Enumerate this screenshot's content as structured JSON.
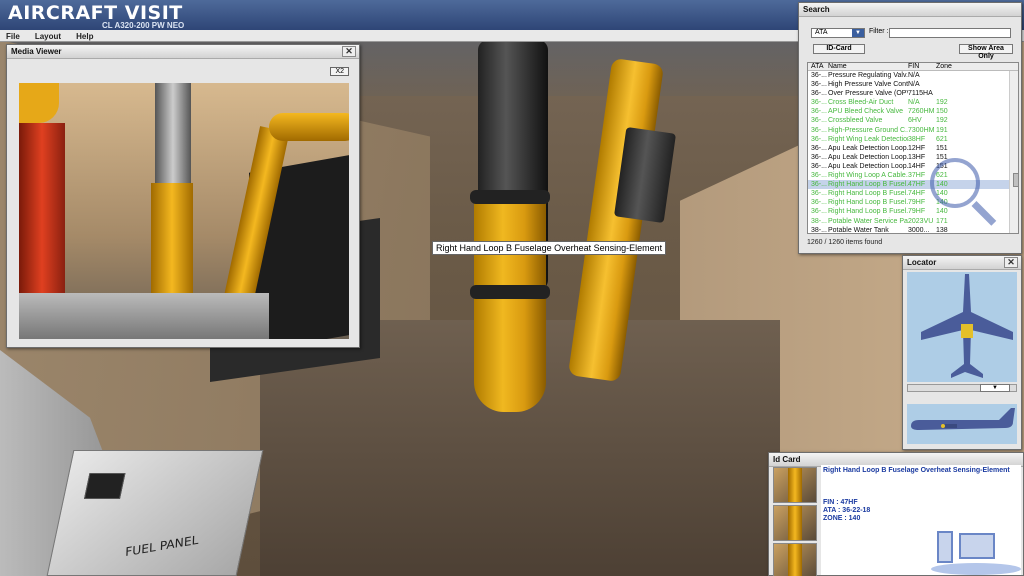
{
  "app": {
    "brand": "AIRCRAFT VISIT",
    "subtitle": "CL A320-200 PW NEO"
  },
  "menu": [
    "File",
    "Layout",
    "Help"
  ],
  "scene": {
    "tooltip": "Right Hand Loop B Fuselage Overheat Sensing-Element",
    "fuel_panel_label": "FUEL PANEL"
  },
  "media_viewer": {
    "title": "Media Viewer",
    "zoom_label": "X2"
  },
  "search": {
    "title": "Search",
    "ata_value": "ATA",
    "filter_label": "Filter :",
    "filter_value": "",
    "idcard_button": "ID-Card",
    "show_area_button": "Show Area Only",
    "columns": [
      "ATA",
      "Name",
      "FIN",
      "Zone"
    ],
    "rows": [
      {
        "ata": "36-...",
        "name": "Pressure Regulating Valv...",
        "fin": "N/A",
        "zone": "",
        "color": "black"
      },
      {
        "ata": "36-...",
        "name": "High Pressure Valve Cont...",
        "fin": "N/A",
        "zone": "",
        "color": "black"
      },
      {
        "ata": "36-...",
        "name": "Over Pressure Valve (OPV)",
        "fin": "7115HA",
        "zone": "",
        "color": "black"
      },
      {
        "ata": "36-...",
        "name": "Cross Bleed-Air Duct",
        "fin": "N/A",
        "zone": "192",
        "color": "green"
      },
      {
        "ata": "36-...",
        "name": "APU Bleed Check Valve",
        "fin": "7260HM",
        "zone": "150",
        "color": "green"
      },
      {
        "ata": "36-...",
        "name": "Crossbleed Valve",
        "fin": "6HV",
        "zone": "192",
        "color": "green"
      },
      {
        "ata": "36-...",
        "name": "High-Pressure Ground C...",
        "fin": "7300HM",
        "zone": "191",
        "color": "green"
      },
      {
        "ata": "36-...",
        "name": "Right Wing Leak Detection...",
        "fin": "38HF",
        "zone": "621",
        "color": "green"
      },
      {
        "ata": "36-...",
        "name": "Apu Leak Detection Loop...",
        "fin": "12HF",
        "zone": "151",
        "color": "black"
      },
      {
        "ata": "36-...",
        "name": "Apu Leak Detection Loop...",
        "fin": "13HF",
        "zone": "151",
        "color": "black"
      },
      {
        "ata": "36-...",
        "name": "Apu Leak Detection Loop...",
        "fin": "14HF",
        "zone": "151",
        "color": "black"
      },
      {
        "ata": "36-...",
        "name": "Right Wing Loop A Cable...",
        "fin": "37HF",
        "zone": "621",
        "color": "green"
      },
      {
        "ata": "36-...",
        "name": "Right Hand Loop B Fusel...",
        "fin": "47HF",
        "zone": "140",
        "color": "green",
        "selected": true
      },
      {
        "ata": "36-...",
        "name": "Right Hand Loop B Fusel...",
        "fin": "74HF",
        "zone": "140",
        "color": "green"
      },
      {
        "ata": "36-...",
        "name": "Right Hand Loop B Fusel...",
        "fin": "79HF",
        "zone": "140",
        "color": "green"
      },
      {
        "ata": "36-...",
        "name": "Right Hand Loop B Fusel...",
        "fin": "79HF",
        "zone": "140",
        "color": "green"
      },
      {
        "ata": "38-...",
        "name": "Potable Water Service Pa...",
        "fin": "2023VU",
        "zone": "171",
        "color": "green"
      },
      {
        "ata": "38-...",
        "name": "Potable Water Tank",
        "fin": "3000...",
        "zone": "138",
        "color": "black"
      }
    ],
    "found_text": "1260 / 1260 items found"
  },
  "locator": {
    "title": "Locator"
  },
  "id_card": {
    "title": "Id Card",
    "name": "Right Hand Loop B Fuselage Overheat Sensing-Element",
    "fin": "FIN : 47HF",
    "ata": "ATA : 36-22-18",
    "zone": "ZONE : 140"
  },
  "colors": {
    "accent": "#2c4374",
    "green_row": "#46b83e",
    "id_text": "#1a3aa0"
  }
}
